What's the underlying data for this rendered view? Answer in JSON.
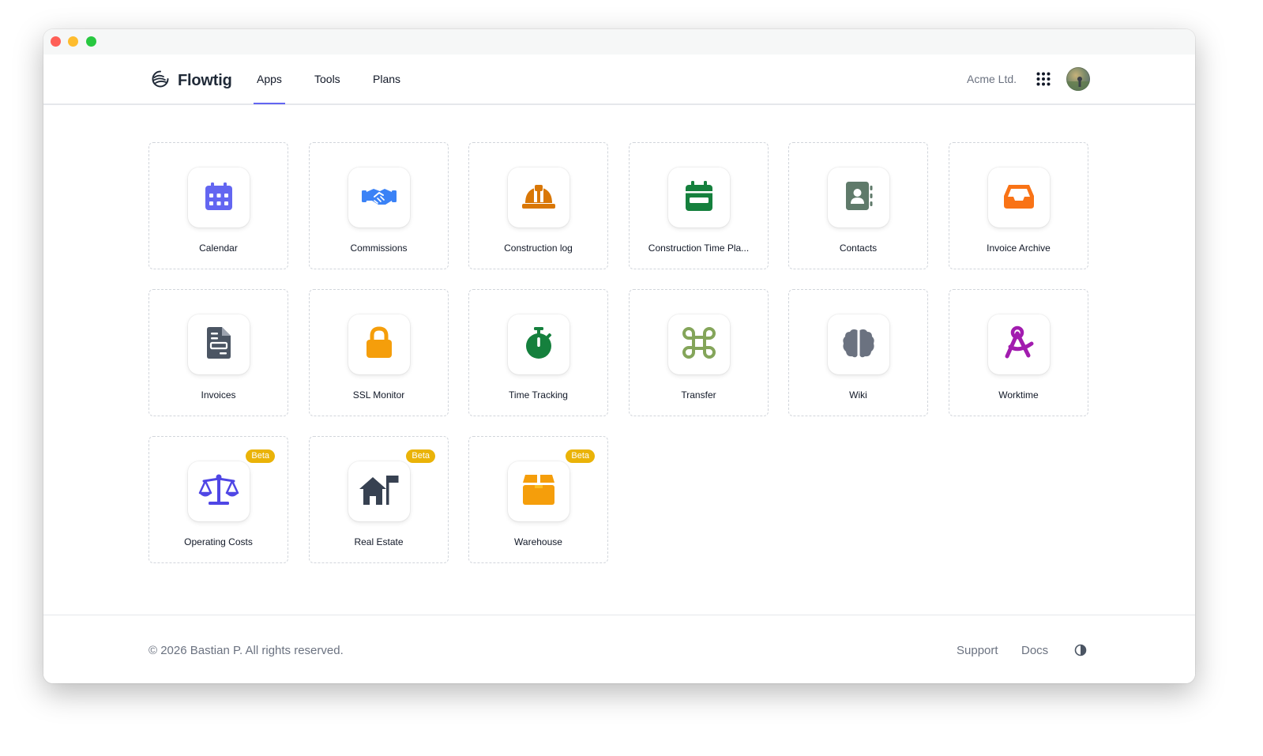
{
  "brand": {
    "name": "Flowtig",
    "accent": "#6366f1"
  },
  "nav": {
    "tabs": [
      "Apps",
      "Tools",
      "Plans"
    ],
    "active": "Apps"
  },
  "org": {
    "name": "Acme Ltd."
  },
  "apps": [
    {
      "label": "Calendar",
      "icon": "calendar-icon",
      "color": "#6366f1"
    },
    {
      "label": "Commissions",
      "icon": "handshake-icon",
      "color": "#3b82f6"
    },
    {
      "label": "Construction log",
      "icon": "hard-hat-icon",
      "color": "#d97706"
    },
    {
      "label": "Construction Time Pla...",
      "icon": "calendar-range-icon",
      "color": "#15803d"
    },
    {
      "label": "Contacts",
      "icon": "address-book-icon",
      "color": "#5f7a6a"
    },
    {
      "label": "Invoice Archive",
      "icon": "inbox-tray-icon",
      "color": "#f97316"
    },
    {
      "label": "Invoices",
      "icon": "invoice-document-icon",
      "color": "#4b5563"
    },
    {
      "label": "SSL Monitor",
      "icon": "lock-icon",
      "color": "#f59e0b"
    },
    {
      "label": "Time Tracking",
      "icon": "stopwatch-icon",
      "color": "#15803d"
    },
    {
      "label": "Transfer",
      "icon": "command-key-icon",
      "color": "#84a55a"
    },
    {
      "label": "Wiki",
      "icon": "brain-icon",
      "color": "#6b7280"
    },
    {
      "label": "Worktime",
      "icon": "compass-drafting-icon",
      "color": "#a21caf"
    },
    {
      "label": "Operating Costs",
      "icon": "scale-balanced-icon",
      "color": "#4f46e5",
      "badge": "Beta"
    },
    {
      "label": "Real Estate",
      "icon": "house-flag-icon",
      "color": "#374151",
      "badge": "Beta"
    },
    {
      "label": "Warehouse",
      "icon": "box-icon",
      "color": "#f59e0b",
      "badge": "Beta"
    }
  ],
  "footer": {
    "copyright": "© 2026 Bastian P. All rights reserved.",
    "links": [
      "Support",
      "Docs"
    ]
  }
}
